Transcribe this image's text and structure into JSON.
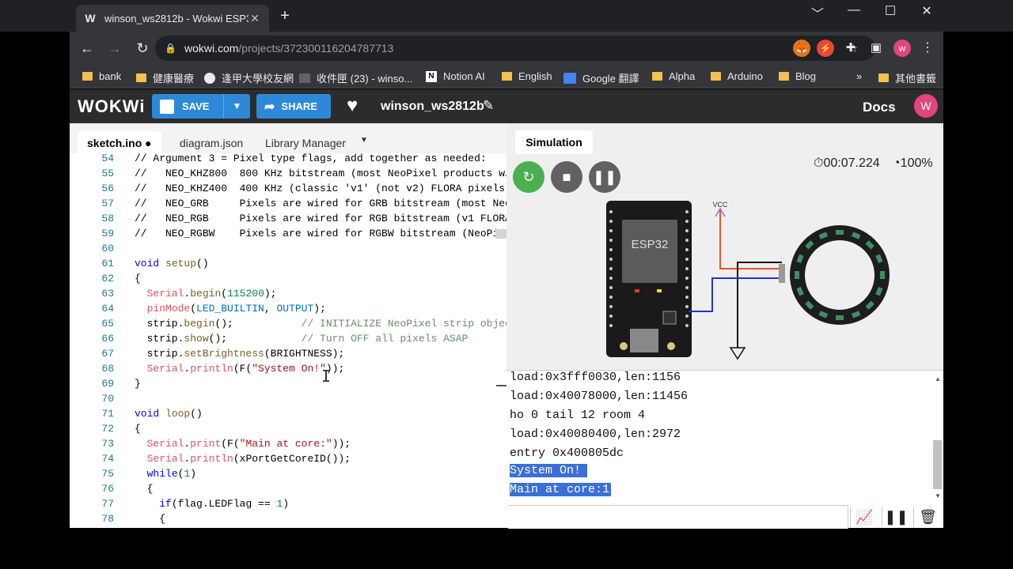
{
  "browser": {
    "tab_title": "winson_ws2812b - Wokwi ESP3",
    "tab_favicon": "W",
    "new_tab": "+",
    "url_host": "wokwi.com",
    "url_path": "/projects/372300116204787713",
    "avatar_letter": "w",
    "window_controls": [
      "﹀",
      "—",
      "☐",
      "✕"
    ]
  },
  "bookmarks": [
    {
      "label": "bank",
      "icon": "folder-icon"
    },
    {
      "label": "健康醫療",
      "icon": "folder-icon"
    },
    {
      "label": "逢甲大學校友網",
      "icon": "globe-icon"
    },
    {
      "label": "收件匣 (23) - winso...",
      "icon": "mail-icon"
    },
    {
      "label": "Notion AI",
      "icon": "notion-icon"
    },
    {
      "label": "English",
      "icon": "folder-icon"
    },
    {
      "label": "Google 翻譯",
      "icon": "translate-icon"
    },
    {
      "label": "Alpha",
      "icon": "folder-icon"
    },
    {
      "label": "Arduino",
      "icon": "folder-icon"
    },
    {
      "label": "Blog",
      "icon": "folder-icon"
    }
  ],
  "bookmarks_more": "»",
  "bookmarks_other": "其他書籤",
  "wokwi": {
    "logo": "WOKWi",
    "save_label": "SAVE",
    "share_label": "SHARE",
    "project_name": "winson_ws2812b",
    "docs_label": "Docs",
    "avatar_letter": "W"
  },
  "editor": {
    "tabs": [
      "sketch.ino ●",
      "diagram.json",
      "Library Manager"
    ]
  },
  "simulation": {
    "tab_label": "Simulation",
    "timer": "00:07.224",
    "speed": "100%",
    "chip_label": "ESP32",
    "vcc_label": "VCC"
  },
  "serial": {
    "lines": [
      "load:0x3fff0030,len:1156",
      "load:0x40078000,len:11456",
      "ho 0 tail 12 room 4",
      "load:0x40080400,len:2972",
      "entry 0x400805dc"
    ],
    "selected_lines": [
      "System On!",
      "Main at core:1"
    ]
  },
  "colors": {
    "accent": "#2e88d8",
    "restart": "#4caf50",
    "ctrl": "#616161",
    "selection": "#3b6fd8"
  }
}
